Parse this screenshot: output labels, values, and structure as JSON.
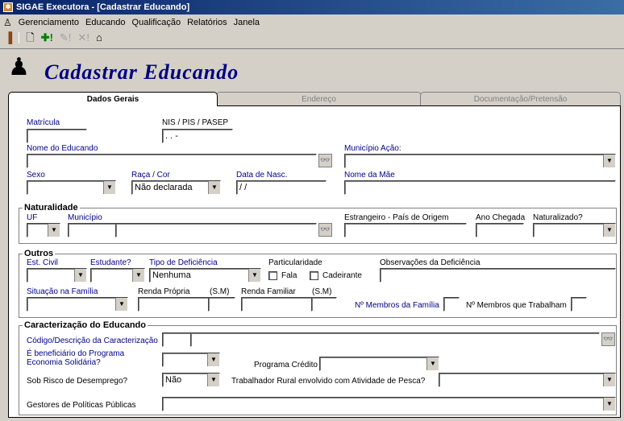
{
  "window": {
    "title": "SIGAE Executora - [Cadastrar Educando]"
  },
  "menu": [
    "Gerenciamento",
    "Educando",
    "Qualificação",
    "Relatórios",
    "Janela"
  ],
  "form": {
    "title": "Cadastrar Educando"
  },
  "tabs": [
    "Dados Gerais",
    "Endereço",
    "Documentação/Pretensão"
  ],
  "fields": {
    "matricula": {
      "label": "Matrícula",
      "value": ""
    },
    "nis": {
      "label": "NIS / PIS / PASEP",
      "value": "  .  .  -"
    },
    "nome": {
      "label": "Nome do Educando",
      "value": ""
    },
    "municipio_acao": {
      "label": "Município Ação:",
      "value": ""
    },
    "sexo": {
      "label": "Sexo",
      "value": ""
    },
    "raca": {
      "label": "Raça / Cor",
      "value": "Não declarada"
    },
    "data_nasc": {
      "label": "Data de Nasc.",
      "value": " / /"
    },
    "nome_mae": {
      "label": "Nome da Mãe",
      "value": ""
    }
  },
  "naturalidade": {
    "title": "Naturalidade",
    "uf": {
      "label": "UF",
      "value": ""
    },
    "municipio": {
      "label": "Município",
      "value": ""
    },
    "estrangeiro": {
      "label": "Estrangeiro - País de Origem",
      "value": ""
    },
    "ano_chegada": {
      "label": "Ano Chegada",
      "value": ""
    },
    "naturalizado": {
      "label": "Naturalizado?",
      "value": ""
    }
  },
  "outros": {
    "title": "Outros",
    "est_civil": {
      "label": "Est. Civil",
      "value": ""
    },
    "estudante": {
      "label": "Estudante?",
      "value": ""
    },
    "tipo_deficiencia": {
      "label": "Tipo de Deficiência",
      "value": "Nenhuma"
    },
    "particularidade": {
      "label": "Particularidade",
      "fala": "Fala",
      "cadeirante": "Cadeirante"
    },
    "obs_deficiencia": {
      "label": "Observações da Deficiência",
      "value": ""
    },
    "situacao_familia": {
      "label": "Situação na Família",
      "value": ""
    },
    "renda_propria": {
      "label": "Renda Própria",
      "unit": "(S.M)",
      "value": ""
    },
    "renda_familiar": {
      "label": "Renda Familiar",
      "unit": "(S.M)",
      "value": ""
    },
    "membros_familia": {
      "label": "Nº Membros da Família",
      "value": ""
    },
    "membros_trabalham": {
      "label": "Nº Membros que Trabalham",
      "value": ""
    }
  },
  "caracterizacao": {
    "title": "Caracterização do Educando",
    "codigo": {
      "label": "Código/Descrição da Caracterização",
      "value": ""
    },
    "beneficiario": {
      "label1": "É beneficiário do Programa",
      "label2": "Economia Solidária?",
      "value": ""
    },
    "programa_credito": {
      "label": "Programa Crédito",
      "value": ""
    },
    "risco_desemprego": {
      "label": "Sob Risco de  Desemprego?",
      "value": "Não"
    },
    "trabalhador_rural": {
      "label": "Trabalhador Rural  envolvido com Atividade de Pesca?",
      "value": ""
    },
    "gestores": {
      "label": "Gestores de Políticas Públicas",
      "value": ""
    }
  }
}
